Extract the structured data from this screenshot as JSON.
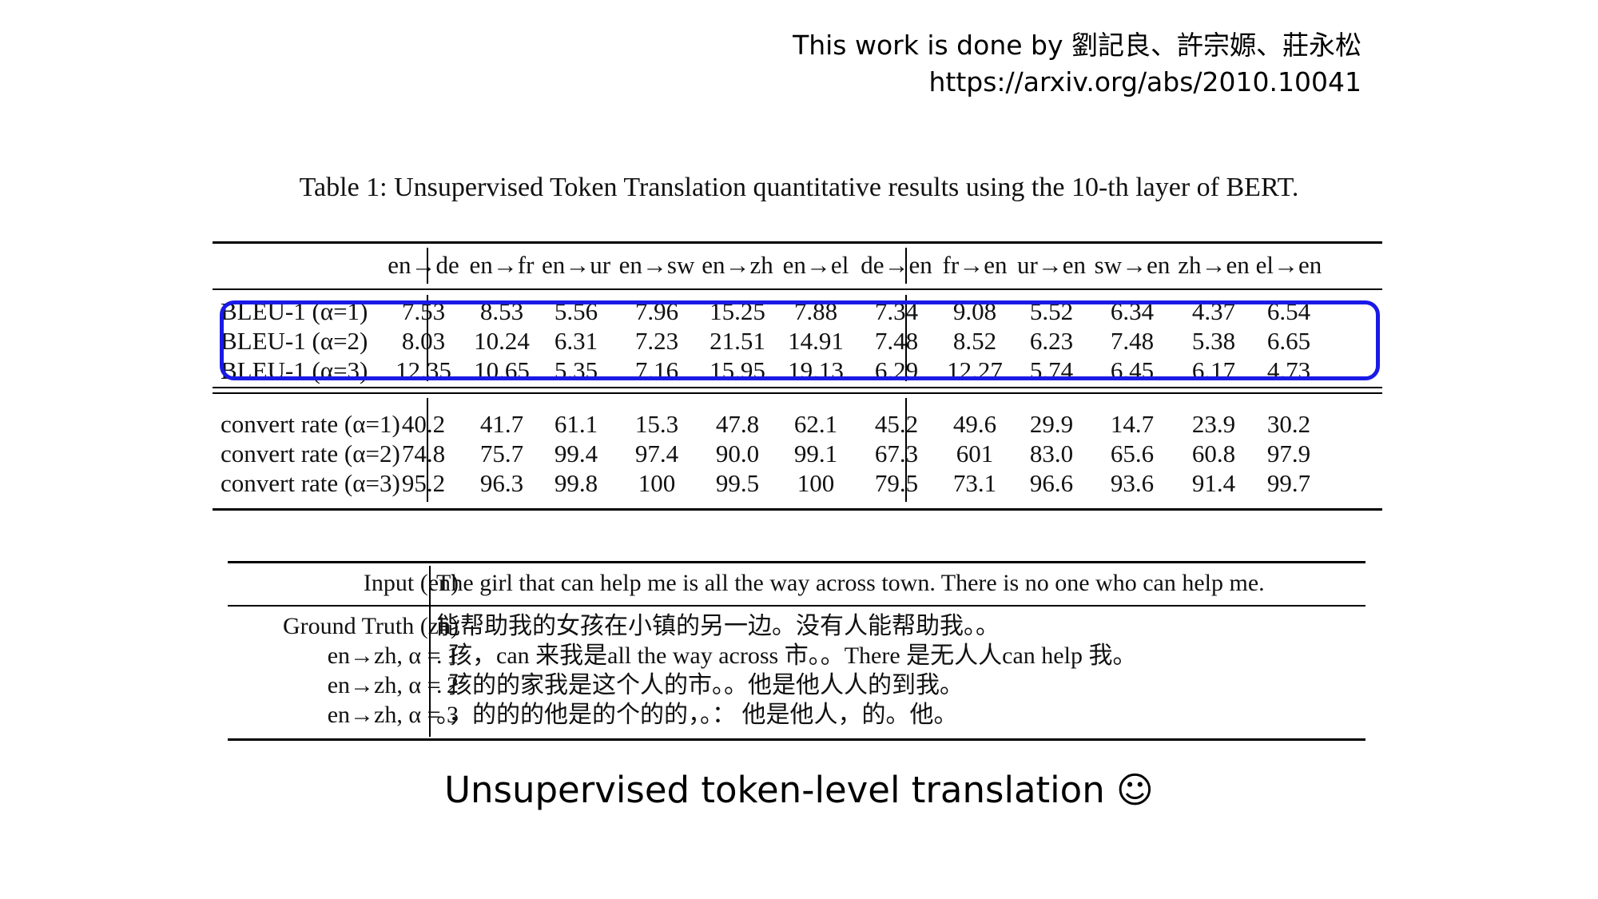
{
  "credit": {
    "line1": "This work is done by 劉記良、許宗嫄、莊永松",
    "line2": "https://arxiv.org/abs/2010.10041"
  },
  "caption": "Table 1: Unsupervised Token Translation quantitative results using the 10-th layer of BERT.",
  "table1": {
    "columns": [
      "en→de",
      "en→fr",
      "en→ur",
      "en→sw",
      "en→zh",
      "en→el",
      "de→en",
      "fr→en",
      "ur→en",
      "sw→en",
      "zh→en",
      "el→en"
    ],
    "bleu_rows": [
      {
        "label": "BLEU-1 (α=1)",
        "values": [
          "7.53",
          "8.53",
          "5.56",
          "7.96",
          "15.25",
          "7.88",
          "7.34",
          "9.08",
          "5.52",
          "6.34",
          "4.37",
          "6.54"
        ]
      },
      {
        "label": "BLEU-1 (α=2)",
        "values": [
          "8.03",
          "10.24",
          "6.31",
          "7.23",
          "21.51",
          "14.91",
          "7.48",
          "8.52",
          "6.23",
          "7.48",
          "5.38",
          "6.65"
        ]
      },
      {
        "label": "BLEU-1 (α=3)",
        "values": [
          "12.35",
          "10.65",
          "5.35",
          "7.16",
          "15.95",
          "19.13",
          "6.29",
          "12.27",
          "5.74",
          "6.45",
          "6.17",
          "4.73"
        ]
      }
    ],
    "convert_rows": [
      {
        "label": "convert rate (α=1)",
        "values": [
          "40.2",
          "41.7",
          "61.1",
          "15.3",
          "47.8",
          "62.1",
          "45.2",
          "49.6",
          "29.9",
          "14.7",
          "23.9",
          "30.2"
        ]
      },
      {
        "label": "convert rate (α=2)",
        "values": [
          "74.8",
          "75.7",
          "99.4",
          "97.4",
          "90.0",
          "99.1",
          "67.3",
          "601",
          "83.0",
          "65.6",
          "60.8",
          "97.9"
        ]
      },
      {
        "label": "convert rate (α=3)",
        "values": [
          "95.2",
          "96.3",
          "99.8",
          "100",
          "99.5",
          "100",
          "79.5",
          "73.1",
          "96.6",
          "93.6",
          "91.4",
          "99.7"
        ]
      }
    ],
    "highlight_color": "#1a1ae6"
  },
  "table2": {
    "input_label": "Input (en)",
    "input_text": "The girl that can help me is all the way across town. There is no one who can help me.",
    "rows": [
      {
        "label": "Ground Truth (zh)",
        "text": "能帮助我的女孩在小镇的另一边。没有人能帮助我。。"
      },
      {
        "label": "en→zh, α = 1",
        "text": ". 孩，can 来我是all the way across 市。。There 是无人人can help 我。"
      },
      {
        "label": "en→zh, α = 2",
        "text": ". 孩的的家我是这个人的市。。他是他人人的到我。"
      },
      {
        "label": "en→zh, α = 3",
        "text": "。，的的的他是的个的的，。： 他是他人，的。他。"
      }
    ]
  },
  "subtitle": "Unsupervised token-level translation ☺"
}
